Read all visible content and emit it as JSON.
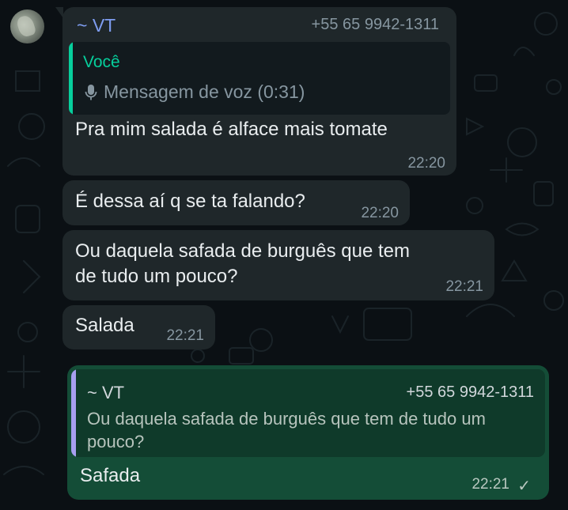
{
  "conversation": {
    "messages": [
      {
        "sender": "~ VT",
        "phone": "+55 65 9942-1311",
        "quote": {
          "author": "Você",
          "icon": "microphone-icon",
          "text": "Mensagem de voz (0:31)"
        },
        "text": "Pra mim salada é alface mais tomate",
        "time": "22:20"
      },
      {
        "text": "É dessa aí q se ta falando?",
        "time": "22:20"
      },
      {
        "text_lines": [
          "Ou daquela safada de burguês que tem",
          "de tudo um pouco?"
        ],
        "time": "22:21"
      },
      {
        "text": "Salada",
        "time": "22:21"
      }
    ],
    "outgoing": {
      "quote": {
        "sender": "~ VT",
        "phone": "+55 65 9942-1311",
        "text": "Ou daquela safada de burguês que tem de tudo um pouco?"
      },
      "text": "Safada",
      "time": "22:21",
      "status_icon": "check-icon"
    }
  },
  "colors": {
    "background": "#0b1014",
    "incoming_bubble": "#1f272a",
    "outgoing_bubble": "#144d37",
    "sender_name": "#7e9df0",
    "quote_accent": "#06cf9c",
    "outgoing_quote_accent": "#a79ff0"
  }
}
